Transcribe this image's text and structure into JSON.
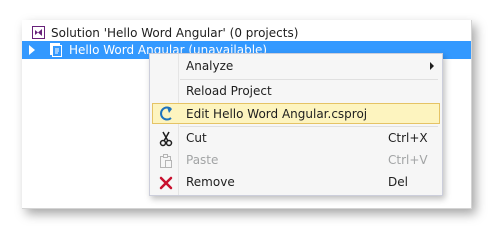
{
  "tree": {
    "solution_label": "Solution 'Hello Word Angular' (0 projects)",
    "project_label": "Hello Word Angular (unavailable)"
  },
  "context_menu": {
    "analyze": "Analyze",
    "reload_project": "Reload Project",
    "edit_project": "Edit Hello Word Angular.csproj",
    "cut": "Cut",
    "cut_shortcut": "Ctrl+X",
    "paste": "Paste",
    "paste_shortcut": "Ctrl+V",
    "remove": "Remove",
    "remove_shortcut": "Del"
  },
  "colors": {
    "selection": "#3399ff",
    "menu_highlight": "#fdf4bf",
    "remove_icon": "#c8102e",
    "vs_purple": "#68217a"
  },
  "icons": [
    "solution-icon",
    "expand-arrow-icon",
    "project-icon",
    "submenu-arrow-icon",
    "edit-icon",
    "cut-icon",
    "paste-icon",
    "remove-icon"
  ]
}
